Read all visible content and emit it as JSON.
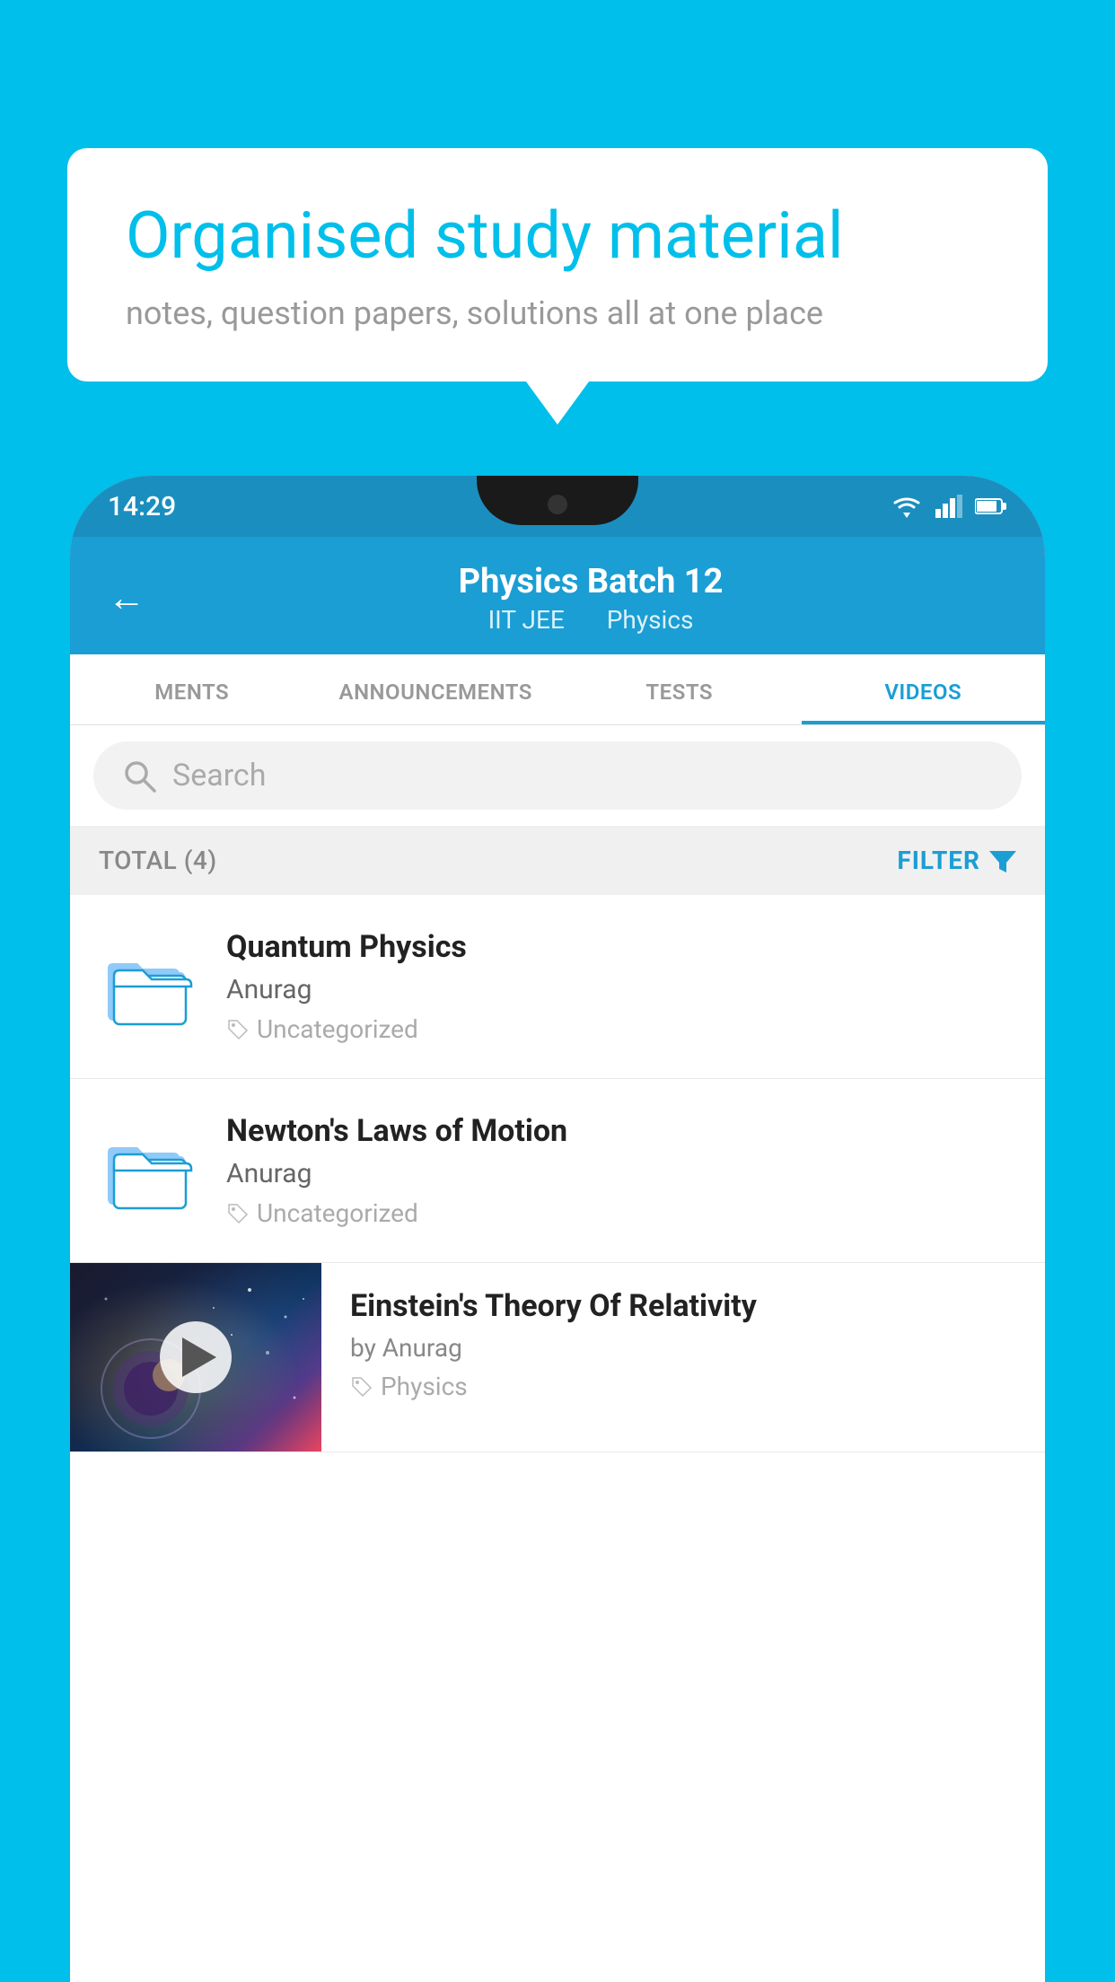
{
  "background_color": "#00BFEA",
  "speech_bubble": {
    "heading": "Organised study material",
    "subtext": "notes, question papers, solutions all at one place"
  },
  "phone": {
    "status_bar": {
      "time": "14:29"
    },
    "app_header": {
      "back_label": "←",
      "title": "Physics Batch 12",
      "subtitle_parts": [
        "IIT JEE",
        "Physics"
      ]
    },
    "tabs": [
      {
        "label": "MENTS",
        "active": false
      },
      {
        "label": "ANNOUNCEMENTS",
        "active": false
      },
      {
        "label": "TESTS",
        "active": false
      },
      {
        "label": "VIDEOS",
        "active": true
      }
    ],
    "search": {
      "placeholder": "Search"
    },
    "filter_bar": {
      "total_label": "TOTAL (4)",
      "filter_label": "FILTER"
    },
    "video_items": [
      {
        "id": "v1",
        "title": "Quantum Physics",
        "author": "Anurag",
        "tag": "Uncategorized",
        "type": "folder"
      },
      {
        "id": "v2",
        "title": "Newton's Laws of Motion",
        "author": "Anurag",
        "tag": "Uncategorized",
        "type": "folder"
      },
      {
        "id": "v3",
        "title": "Einstein's Theory Of Relativity",
        "author": "by Anurag",
        "tag": "Physics",
        "type": "video"
      }
    ]
  }
}
